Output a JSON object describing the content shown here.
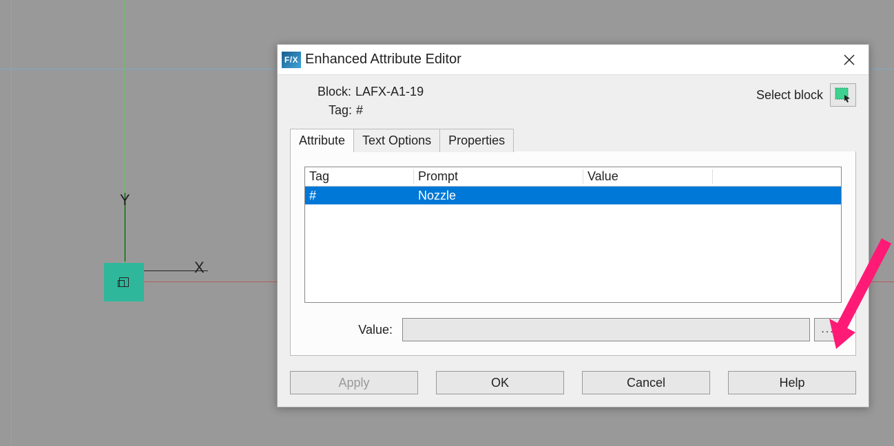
{
  "fx_icon_text": "F/X",
  "window": {
    "title": "Enhanced Attribute Editor"
  },
  "header": {
    "block_label": "Block:",
    "block_value": "LAFX-A1-19",
    "tag_label": "Tag:",
    "tag_value": "#",
    "select_block_label": "Select block"
  },
  "tabs": {
    "attribute": "Attribute",
    "text_options": "Text Options",
    "properties": "Properties"
  },
  "grid": {
    "columns": {
      "tag": "Tag",
      "prompt": "Prompt",
      "value": "Value"
    },
    "rows": [
      {
        "tag": "#",
        "prompt": "Nozzle",
        "value": ""
      }
    ]
  },
  "value_field": {
    "label": "Value:",
    "value": "",
    "browse": "..."
  },
  "buttons": {
    "apply": "Apply",
    "ok": "OK",
    "cancel": "Cancel",
    "help": "Help"
  },
  "axes": {
    "x": "X",
    "y": "Y"
  }
}
